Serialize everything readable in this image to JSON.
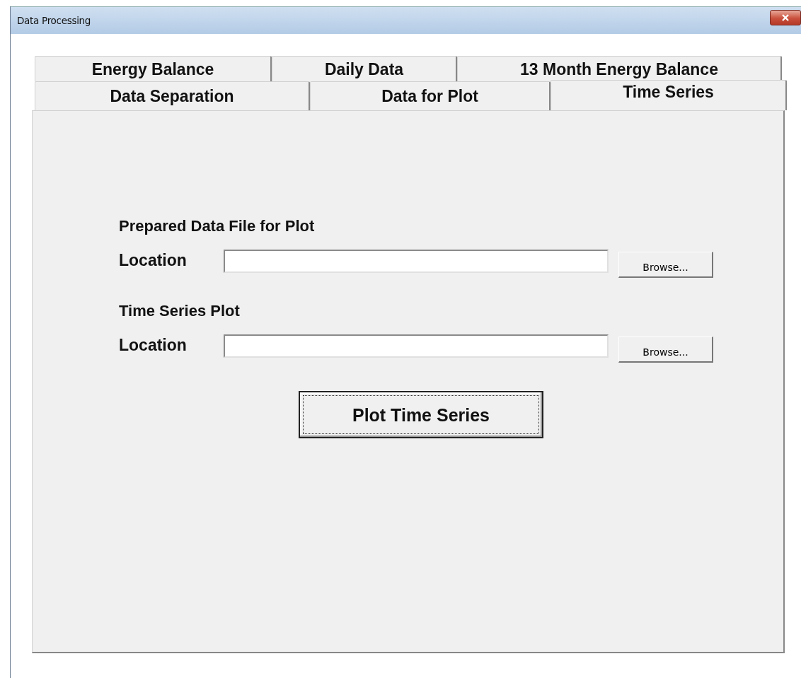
{
  "window": {
    "title": "Data Processing"
  },
  "tab_rows": [
    [
      {
        "label": "Energy Balance",
        "selected": false
      },
      {
        "label": "Daily Data",
        "selected": false
      },
      {
        "label": "13 Month Energy Balance",
        "selected": false
      }
    ],
    [
      {
        "label": "Data Separation",
        "selected": false
      },
      {
        "label": "Data for Plot",
        "selected": false
      },
      {
        "label": "Time Series",
        "selected": true
      }
    ]
  ],
  "sections": [
    {
      "title": "Prepared Data File for Plot",
      "label": "Location",
      "button": "Browse..."
    },
    {
      "title": "Time Series Plot",
      "label": "Location",
      "button": "Browse..."
    }
  ],
  "action_button": "Plot Time Series"
}
